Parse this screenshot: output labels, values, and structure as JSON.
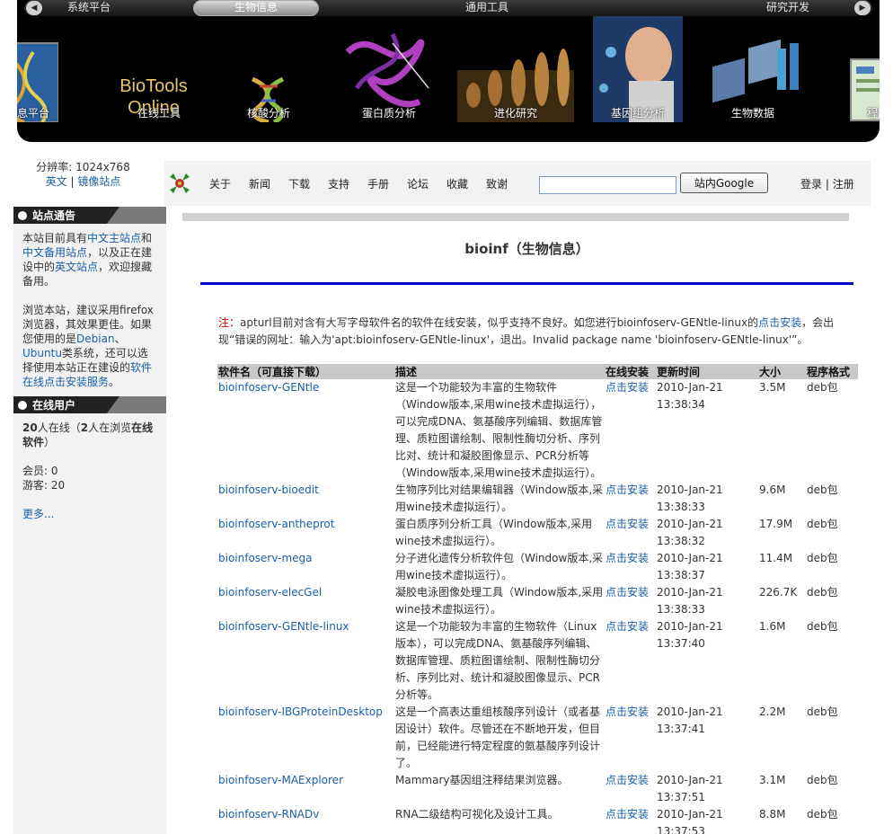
{
  "topnav": {
    "tabs": [
      {
        "label": "系统平台"
      },
      {
        "label": "生物信息"
      },
      {
        "label": "通用工具"
      },
      {
        "label": "研究开发"
      }
    ]
  },
  "banner": {
    "brand": "BioTools\nOnline",
    "thumbs": [
      {
        "caption": "信息平台",
        "icon": "dna-image"
      },
      {
        "caption": "在线工具",
        "icon": "brand-logo"
      },
      {
        "caption": "核酸分析",
        "icon": "dna-helix-image"
      },
      {
        "caption": "蛋白质分析",
        "icon": "protein-image"
      },
      {
        "caption": "进化研究",
        "icon": "evolution-image"
      },
      {
        "caption": "基因组分析",
        "icon": "genome-image"
      },
      {
        "caption": "生物数据",
        "icon": "data-image"
      },
      {
        "caption": "程序",
        "icon": "program-image"
      }
    ]
  },
  "resinfo": {
    "resolution_label": "分辨率:",
    "resolution": "1024x768",
    "english": "英文",
    "mirror": "镜像站点"
  },
  "toolbar": {
    "items": [
      "关于",
      "新闻",
      "下载",
      "支持",
      "手册",
      "论坛",
      "收藏",
      "致谢"
    ],
    "search_button": "站内Google",
    "login": "登录",
    "register": "注册"
  },
  "sidebar": {
    "notice_title": "站点通告",
    "notice": {
      "p1_a": "本站目前具有",
      "p1_link1": "中文主站点",
      "p1_b": "和",
      "p1_link2": "中文备用站点",
      "p1_c": "，以及正在建设中的",
      "p1_link3": "英文站点",
      "p1_d": "，欢迎搜藏备用。",
      "p2_a": "浏览本站，建议采用firefox浏览器，其效果更佳。如果您使用的是",
      "p2_link1": "Debian",
      "p2_b": "、",
      "p2_link2": "Ubuntu",
      "p2_c": "类系统，还可以选择使用本站正在建设的",
      "p2_link3": "软件在线点击安装服务",
      "p2_d": "。"
    },
    "users_title": "在线用户",
    "users": {
      "online_count": "20",
      "online_text": "人在线（",
      "browsing_count": "2",
      "browsing_text": "人在浏览",
      "browsing_page": "在线软件",
      "close_paren": "）",
      "members": "会员: 0",
      "guests": "游客: 20",
      "more": "更多..."
    }
  },
  "main": {
    "title": "bioinf（生物信息）",
    "notice_label": "注：",
    "notice_a": "apturl目前对含有大写字母软件名的软件在线安装，似乎支持不良好。如您进行bioinfoserv-GENtle-linux的",
    "notice_link": "点击安装",
    "notice_b": "，会出现“错误的网址：输入为'apt:bioinfoserv-GENtle-linux'，退出。Invalid package name 'bioinfoserv-GENtle-linux'”。"
  },
  "table": {
    "headers": [
      "软件名（可直接下载）",
      "描述",
      "在线安装",
      "更新时间",
      "大小",
      "程序格式"
    ],
    "rows": [
      {
        "name": "bioinfoserv-GENtle",
        "desc": "这是一个功能较为丰富的生物软件（Window版本,采用wine技术虚拟运行），可以完成DNA、氨基酸序列编辑、数据库管理、质粒图谱绘制、限制性酶切分析、序列比对、统计和凝胶图像显示、PCR分析等（Window版本,采用wine技术虚拟运行）。",
        "install": "点击安装",
        "date": "2010-Jan-21",
        "time": "13:38:34",
        "size": "3.5M",
        "format": "deb包"
      },
      {
        "name": "bioinfoserv-bioedit",
        "desc": "生物序列比对结果编辑器（Window版本,采用wine技术虚拟运行）。",
        "install": "点击安装",
        "date": "2010-Jan-21",
        "time": "13:38:33",
        "size": "9.6M",
        "format": "deb包"
      },
      {
        "name": "bioinfoserv-antheprot",
        "desc": "蛋白质序列分析工具（Window版本,采用wine技术虚拟运行）。",
        "install": "点击安装",
        "date": "2010-Jan-21",
        "time": "13:38:32",
        "size": "17.9M",
        "format": "deb包"
      },
      {
        "name": "bioinfoserv-mega",
        "desc": "分子进化遗传分析软件包（Window版本,采用wine技术虚拟运行）。",
        "install": "点击安装",
        "date": "2010-Jan-21",
        "time": "13:38:37",
        "size": "11.4M",
        "format": "deb包"
      },
      {
        "name": "bioinfoserv-elecGel",
        "desc": "凝胶电泳图像处理工具（Window版本,采用wine技术虚拟运行）。",
        "install": "点击安装",
        "date": "2010-Jan-21",
        "time": "13:38:33",
        "size": "226.7K",
        "format": "deb包"
      },
      {
        "name": "bioinfoserv-GENtle-linux",
        "desc": "这是一个功能较为丰富的生物软件（Linux版本），可以完成DNA、氨基酸序列编辑、数据库管理、质粒图谱绘制、限制性酶切分析、序列比对、统计和凝胶图像显示、PCR分析等。",
        "install": "点击安装",
        "date": "2010-Jan-21",
        "time": "13:37:40",
        "size": "1.6M",
        "format": "deb包"
      },
      {
        "name": "bioinfoserv-IBGProteinDesktop",
        "desc": "这是一个高表达重组核酸序列设计（或者基因设计）软件。尽管还在不断地开发，但目前，已经能进行特定程度的氨基酸序列设计了。",
        "install": "点击安装",
        "date": "2010-Jan-21",
        "time": "13:37:41",
        "size": "2.2M",
        "format": "deb包"
      },
      {
        "name": "bioinfoserv-MAExplorer",
        "desc": "Mammary基因组注释结果浏览器。",
        "install": "点击安装",
        "date": "2010-Jan-21",
        "time": "13:37:51",
        "size": "3.1M",
        "format": "deb包"
      },
      {
        "name": "bioinfoserv-RNADv",
        "desc": "RNA二级结构可视化及设计工具。",
        "install": "点击安装",
        "date": "2010-Jan-21",
        "time": "13:37:53",
        "size": "8.8M",
        "format": "deb包"
      }
    ]
  }
}
